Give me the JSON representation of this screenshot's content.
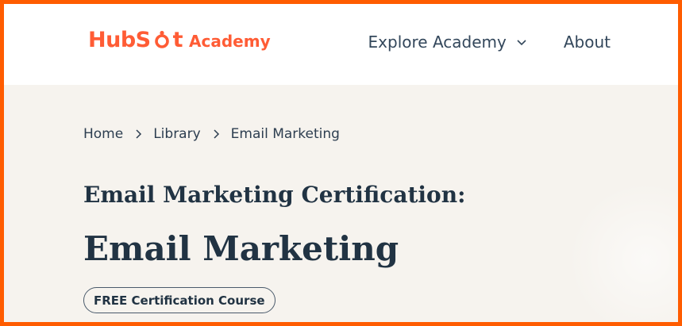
{
  "header": {
    "logo": {
      "brand": "HubSpot",
      "suffix": "Academy"
    },
    "nav": [
      {
        "label": "Explore Academy",
        "has_dropdown": true
      },
      {
        "label": "About",
        "has_dropdown": false
      }
    ]
  },
  "breadcrumb": [
    "Home",
    "Library",
    "Email Marketing"
  ],
  "hero": {
    "subtitle": "Email Marketing Certification:",
    "title": "Email Marketing",
    "badge": "FREE Certification Course"
  },
  "colors": {
    "frame": "#ff5c00",
    "brand": "#ff5c35",
    "text": "#213343",
    "hero_bg": "#f6f3ee"
  },
  "icons": {
    "logo": "hubspot-sprocket-icon",
    "dropdown": "chevron-down-icon",
    "breadcrumb_separator": "chevron-right-icon"
  }
}
